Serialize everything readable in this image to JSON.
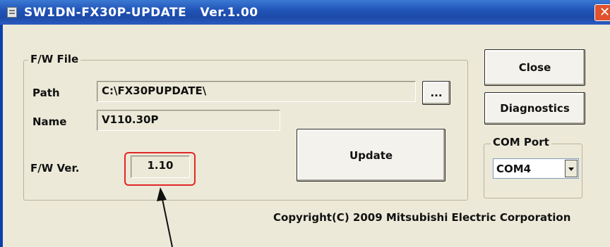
{
  "window": {
    "title": "SW1DN-FX30P-UPDATE   Ver.1.00",
    "close_glyph": "✕"
  },
  "fw_file": {
    "group_label": "F/W File",
    "path_label": "Path",
    "path_value": "C:\\FX30PUPDATE\\",
    "browse_label": "...",
    "name_label": "Name",
    "name_value": "V110.30P",
    "fw_ver_label": "F/W Ver.",
    "fw_ver_value": "1.10"
  },
  "buttons": {
    "close": "Close",
    "diagnostics": "Diagnostics",
    "update": "Update"
  },
  "com_port": {
    "group_label": "COM Port",
    "selected": "COM4"
  },
  "footer": {
    "copyright": "Copyright(C) 2009 Mitsubishi Electric Corporation"
  },
  "annotation": {
    "highlight_color": "#e42626"
  }
}
